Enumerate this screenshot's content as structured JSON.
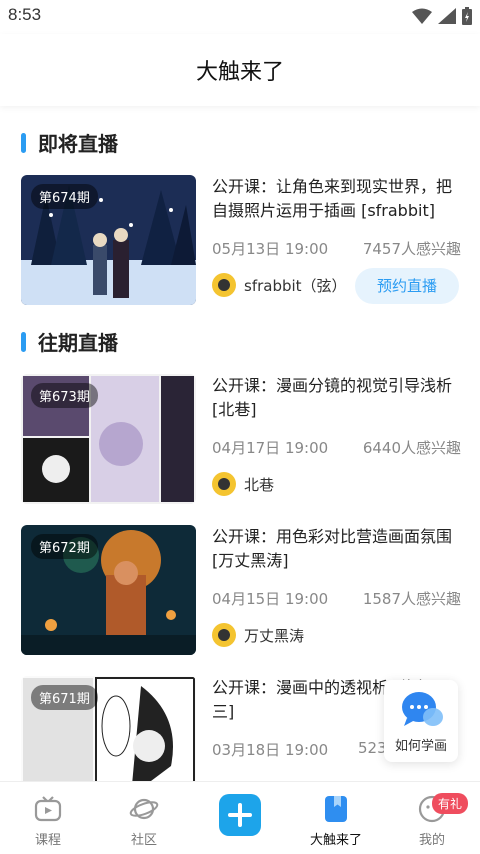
{
  "status": {
    "time": "8:53"
  },
  "header": {
    "title": "大触来了"
  },
  "sections": {
    "upcoming": {
      "title": "即将直播"
    },
    "past": {
      "title": "往期直播"
    }
  },
  "upcoming": [
    {
      "episode": "第674期",
      "title": "公开课：让角色来到现实世界，把自摄照片运用于插画 [sfrabbit]",
      "date": "05月13日 19:00",
      "interest": "7457人感兴趣",
      "teacher": "sfrabbit（弦）",
      "action": "预约直播"
    }
  ],
  "past": [
    {
      "episode": "第673期",
      "title": "公开课：漫画分镜的视觉引导浅析 [北巷]",
      "date": "04月17日 19:00",
      "interest": "6440人感兴趣",
      "teacher": "北巷"
    },
    {
      "episode": "第672期",
      "title": "公开课：用色彩对比营造画面氛围 [万丈黑涛]",
      "date": "04月15日 19:00",
      "interest": "1587人感兴趣",
      "teacher": "万丈黑涛"
    },
    {
      "episode": "第671期",
      "title": "公开课：漫画中的透视析 [修勾三三]",
      "date": "03月18日 19:00",
      "interest": "523"
    }
  ],
  "float_help": {
    "label": "如何学画",
    "icon": "chat-bubble-icon"
  },
  "bottom_nav": {
    "items": [
      {
        "label": "课程",
        "icon": "tv-icon"
      },
      {
        "label": "社区",
        "icon": "planet-icon"
      },
      {
        "label": "",
        "icon": "plus-icon"
      },
      {
        "label": "大触来了",
        "icon": "bookmark-icon"
      },
      {
        "label": "我的",
        "icon": "face-icon"
      }
    ],
    "badge": "有礼"
  },
  "colors": {
    "accent": "#2b9cf2",
    "badge": "#ef4d5e"
  }
}
